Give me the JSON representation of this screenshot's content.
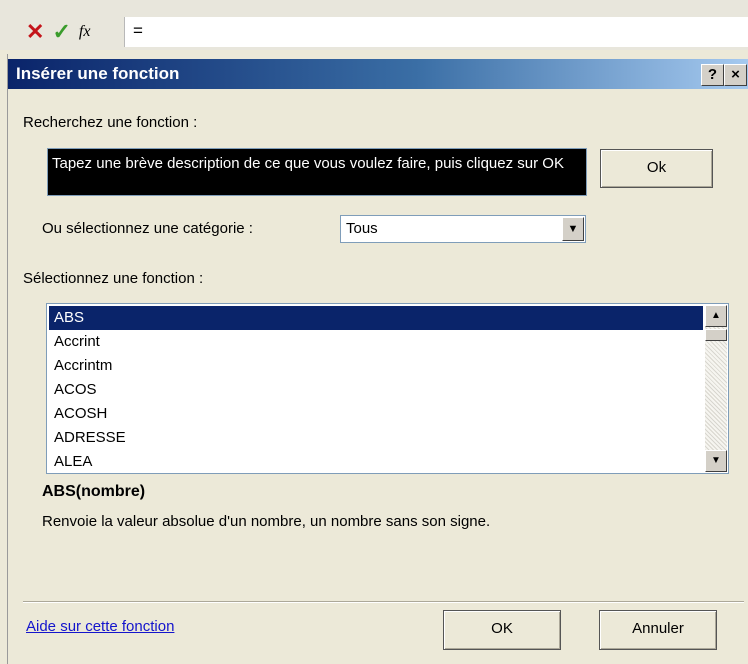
{
  "formula_bar": {
    "cancel_icon": "✕",
    "enter_icon": "✓",
    "fx_label": "fx",
    "content": "="
  },
  "dialog": {
    "title": "Insérer une fonction",
    "help_button": "?",
    "close_button": "×",
    "search_label": "Recherchez une fonction :",
    "search_value": "Tapez une brève description de ce que vous voulez faire, puis cliquez sur OK",
    "search_ok": "Ok",
    "category_label": "Ou sélectionnez une catégorie :",
    "category_value": "Tous",
    "function_label": "Sélectionnez une fonction :",
    "functions": [
      "ABS",
      "Accrint",
      "Accrintm",
      "ACOS",
      "ACOSH",
      "ADRESSE",
      "ALEA"
    ],
    "selected_function_index": 0,
    "signature": "ABS(nombre)",
    "description": "Renvoie la valeur absolue d'un nombre, un nombre sans son signe.",
    "help_link": "Aide sur cette fonction",
    "ok_label": "OK",
    "cancel_label": "Annuler"
  },
  "colors": {
    "title_gradient_start": "#0a246a",
    "title_gradient_end": "#a6caf0",
    "selection": "#0a246a",
    "link": "#1414cc",
    "cancel_icon": "#c4141a",
    "enter_icon": "#3a9c2c"
  }
}
